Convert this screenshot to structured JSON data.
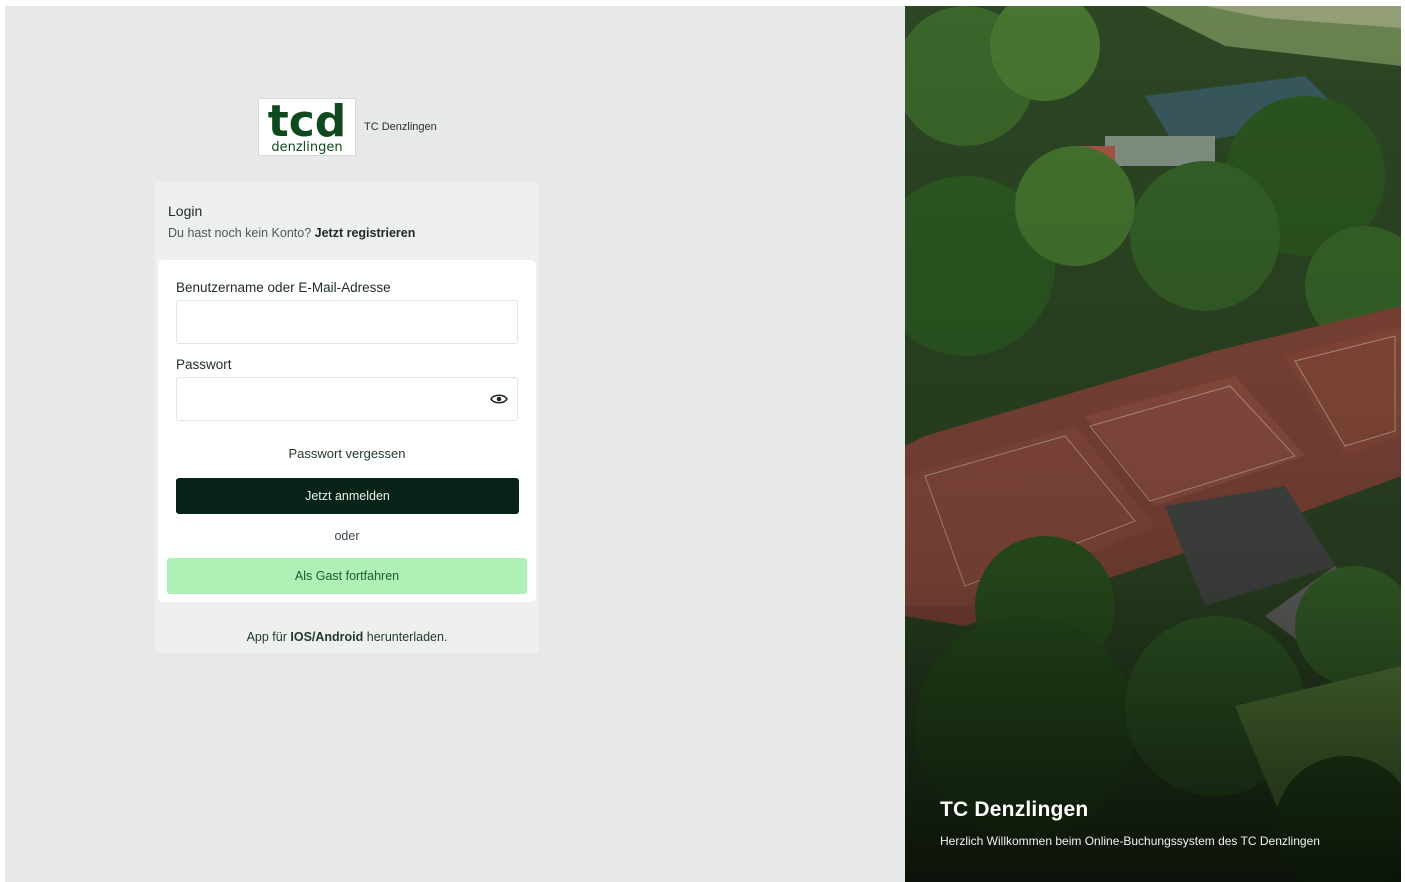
{
  "brand": {
    "logo_word": "tcd",
    "logo_sub": "denzlingen",
    "name": "TC Denzlingen"
  },
  "login": {
    "title": "Login",
    "no_account_text": "Du hast noch kein Konto?",
    "register_link": "Jetzt registrieren",
    "username_label": "Benutzername oder E-Mail-Adresse",
    "username_value": "",
    "password_label": "Passwort",
    "password_value": "",
    "forgot_link": "Passwort vergessen",
    "submit_label": "Jetzt anmelden",
    "divider_text": "oder",
    "guest_label": "Als Gast fortfahren",
    "app_prefix": "App für",
    "app_link": "IOS/Android",
    "app_suffix": "herunterladen."
  },
  "hero": {
    "title": "TC Denzlingen",
    "subtitle": "Herzlich Willkommen beim Online-Buchungssystem des TC Denzlingen"
  },
  "colors": {
    "primary": "#072216",
    "guest_button": "#adf1b6",
    "logo_green": "#0f4a1e",
    "page_background": "#e7e9e8"
  },
  "icons": {
    "password_toggle": "eye-icon"
  }
}
